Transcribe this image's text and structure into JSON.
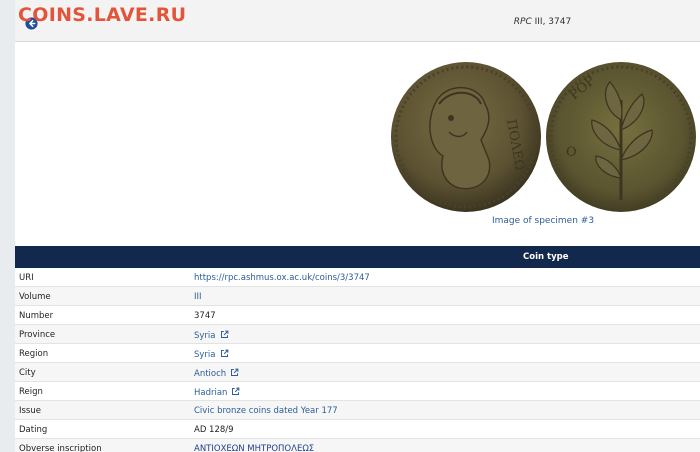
{
  "watermark": "COINS.LAVE.RU",
  "header": {
    "title_italic": "RPC",
    "title_rest": " III, 3747"
  },
  "image_caption": "Image of specimen #3",
  "table": {
    "header": "Coin type",
    "rows": [
      {
        "label": "URI",
        "value": "https://rpc.ashmus.ox.ac.uk/coins/3/3747"
      },
      {
        "label": "Volume",
        "value": "III"
      },
      {
        "label": "Number",
        "value": "3747"
      },
      {
        "label": "Province",
        "value": "Syria"
      },
      {
        "label": "Region",
        "value": "Syria"
      },
      {
        "label": "City",
        "value": "Antioch"
      },
      {
        "label": "Reign",
        "value": "Hadrian"
      },
      {
        "label": "Issue",
        "value": "Civic bronze coins dated Year 177"
      },
      {
        "label": "Dating",
        "value": "AD 128/9"
      },
      {
        "label": "Obverse inscription",
        "value": "ΑΝΤΙΟΧΕΩΝ ΜΗΤΡΟΠΟΛΕΩΣ"
      }
    ]
  },
  "colors": {
    "table_header_bg": "#12284c",
    "link": "#2c5d98",
    "watermark": "#e2553a"
  },
  "icons": {
    "back": "arrow-left-circle-icon",
    "external": "external-link-icon"
  }
}
